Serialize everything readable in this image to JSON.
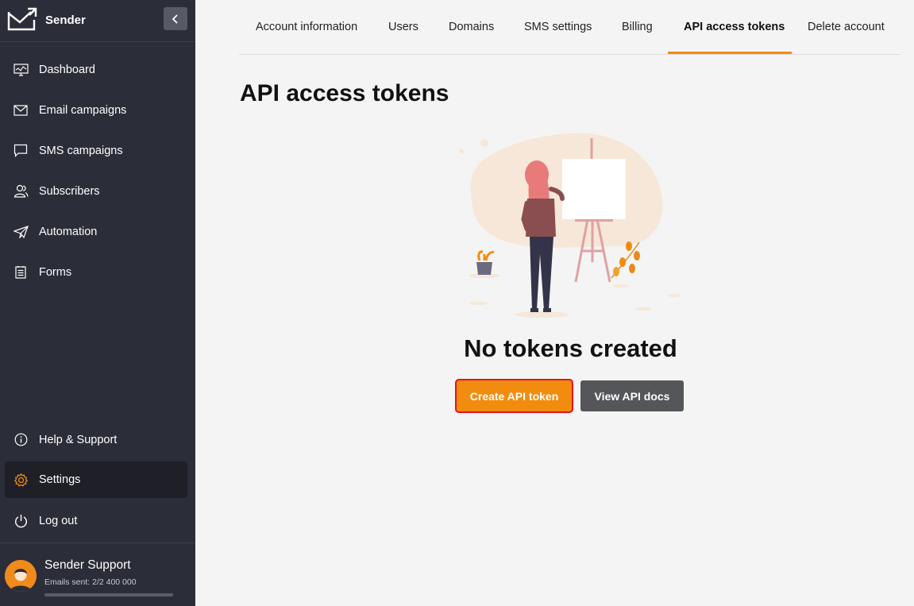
{
  "sidebar": {
    "brand_name": "Sender",
    "nav_top": [
      {
        "label": "Dashboard",
        "icon": "dashboard-icon"
      },
      {
        "label": "Email campaigns",
        "icon": "envelope-icon"
      },
      {
        "label": "SMS campaigns",
        "icon": "chat-bubble-icon"
      },
      {
        "label": "Subscribers",
        "icon": "users-icon"
      },
      {
        "label": "Automation",
        "icon": "paper-plane-icon"
      },
      {
        "label": "Forms",
        "icon": "form-icon"
      }
    ],
    "nav_bottom": [
      {
        "label": "Help & Support",
        "icon": "info-icon"
      },
      {
        "label": "Settings",
        "icon": "gear-icon",
        "active": true
      },
      {
        "label": "Log out",
        "icon": "power-icon"
      }
    ],
    "user": {
      "name": "Sender Support",
      "emails_sent": "Emails sent: 2/2 400 000",
      "usage_fraction": 0.0
    }
  },
  "tabs": [
    {
      "label": "Account information"
    },
    {
      "label": "Users"
    },
    {
      "label": "Domains"
    },
    {
      "label": "SMS settings"
    },
    {
      "label": "Billing"
    },
    {
      "label": "API access tokens",
      "active": true
    },
    {
      "label": "Delete account"
    }
  ],
  "main": {
    "title": "API access tokens",
    "empty_title": "No tokens created",
    "create_button": "Create API token",
    "docs_button": "View API docs"
  },
  "colors": {
    "accent": "#f28c0f",
    "sidebar_bg": "#2b2d38",
    "highlight_border": "#e8101c"
  }
}
